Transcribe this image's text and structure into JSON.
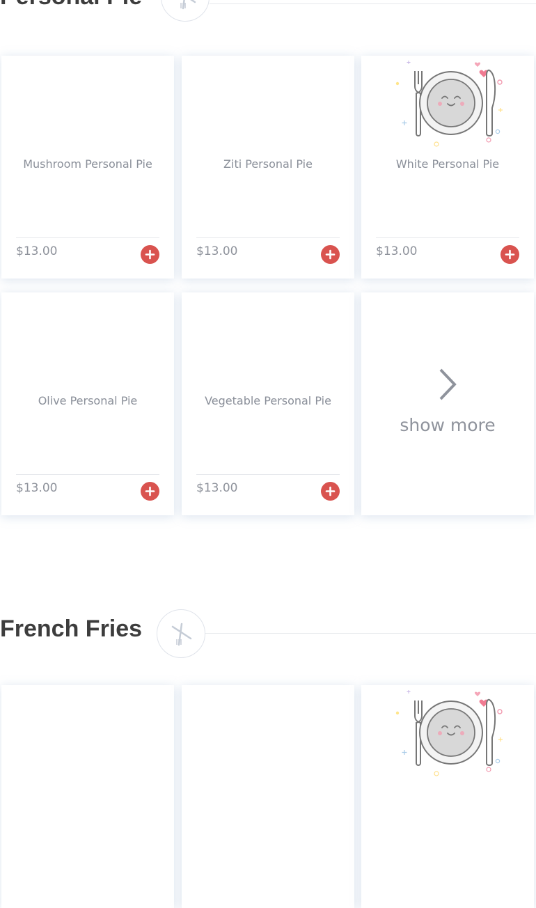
{
  "sections": [
    {
      "title": "Personal Pie",
      "items": [
        {
          "name": "Mushroom Personal Pie",
          "price": "$13.00"
        },
        {
          "name": "Ziti Personal Pie",
          "price": "$13.00"
        },
        {
          "name": "White Personal Pie",
          "price": "$13.00"
        },
        {
          "name": "Olive Personal Pie",
          "price": "$13.00"
        },
        {
          "name": "Vegetable Personal Pie",
          "price": "$13.00"
        }
      ],
      "show_more": "show more"
    },
    {
      "title": "French Fries"
    }
  ],
  "colors": {
    "add_button": "#d9534f",
    "title": "#3d3d3d",
    "muted_text": "#8f939c"
  },
  "icons": {
    "section_badge": "fork-knife-icon",
    "placeholder": "smiling-plate-icon",
    "add": "plus-icon",
    "show_more": "chevron-right-icon"
  }
}
